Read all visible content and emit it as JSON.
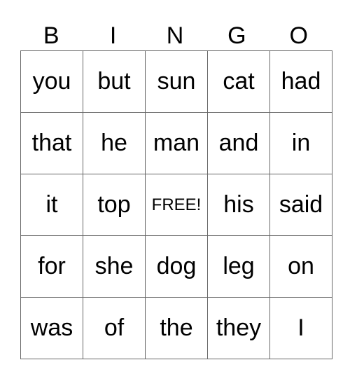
{
  "header": [
    "B",
    "I",
    "N",
    "G",
    "O"
  ],
  "rows": [
    [
      "you",
      "but",
      "sun",
      "cat",
      "had"
    ],
    [
      "that",
      "he",
      "man",
      "and",
      "in"
    ],
    [
      "it",
      "top",
      "FREE!",
      "his",
      "said"
    ],
    [
      "for",
      "she",
      "dog",
      "leg",
      "on"
    ],
    [
      "was",
      "of",
      "the",
      "they",
      "I"
    ]
  ]
}
